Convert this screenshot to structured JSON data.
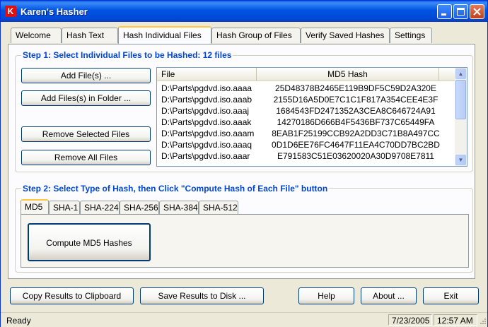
{
  "window": {
    "title": "Karen's Hasher",
    "icon_letter": "K"
  },
  "tabs": [
    {
      "label": "Welcome"
    },
    {
      "label": "Hash Text"
    },
    {
      "label": "Hash Individual Files"
    },
    {
      "label": "Hash Group of Files"
    },
    {
      "label": "Verify Saved Hashes"
    },
    {
      "label": "Settings"
    }
  ],
  "step1": {
    "title": "Step 1: Select Individual Files to be Hashed: 12 files",
    "buttons": {
      "add_files": "Add File(s) ...",
      "add_files_folder": "Add Files(s) in Folder ...",
      "remove_selected": "Remove Selected Files",
      "remove_all": "Remove All Files"
    },
    "list": {
      "headers": {
        "file": "File",
        "hash": "MD5 Hash"
      },
      "rows": [
        {
          "file": "D:\\Parts\\pgdvd.iso.aaaa",
          "hash": "25D48378B2465E119B9DF5C59D2A320E"
        },
        {
          "file": "D:\\Parts\\pgdvd.iso.aaab",
          "hash": "2155D16A5D0E7C1C1F817A354CEE4E3F"
        },
        {
          "file": "D:\\Parts\\pgdvd.iso.aaaj",
          "hash": "1684543FD2471352A3CEA8C646724A91"
        },
        {
          "file": "D:\\Parts\\pgdvd.iso.aaak",
          "hash": "14270186D666B4F5436BF737C65449FA"
        },
        {
          "file": "D:\\Parts\\pgdvd.iso.aaam",
          "hash": "8EAB1F25199CCB92A2DD3C71B8A497CC"
        },
        {
          "file": "D:\\Parts\\pgdvd.iso.aaaq",
          "hash": "0D1D6EE76FC4647F11EA4C70DD7BC2BD"
        },
        {
          "file": "D:\\Parts\\pgdvd.iso.aaar",
          "hash": "E791583C51E03620020A30D9708E7811"
        }
      ]
    }
  },
  "step2": {
    "title": "Step 2: Select Type of Hash, then Click \"Compute Hash of Each File\" button",
    "hash_tabs": [
      {
        "label": "MD5"
      },
      {
        "label": "SHA-1"
      },
      {
        "label": "SHA-224"
      },
      {
        "label": "SHA-256"
      },
      {
        "label": "SHA-384"
      },
      {
        "label": "SHA-512"
      }
    ],
    "compute_button": "Compute MD5 Hashes"
  },
  "bottom_buttons": {
    "copy": "Copy Results to Clipboard",
    "save": "Save Results to Disk ...",
    "help": "Help",
    "about": "About ...",
    "exit": "Exit"
  },
  "status": {
    "text": "Ready",
    "date": "7/23/2005",
    "time": "12:57 AM"
  },
  "colors": {
    "accent": "#0046D5",
    "titlebar": "#0054E3",
    "tab_highlight": "#FFC83C"
  }
}
